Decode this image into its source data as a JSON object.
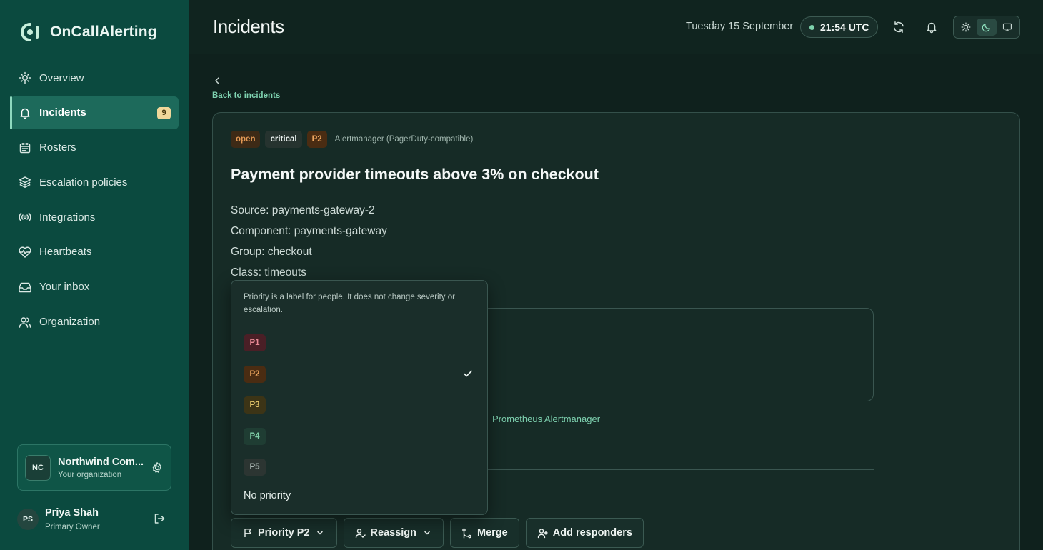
{
  "app": {
    "name": "OnCallAlerting"
  },
  "sidebar": {
    "items": [
      {
        "label": "Overview",
        "icon": "sun-icon"
      },
      {
        "label": "Incidents",
        "icon": "bell-icon",
        "badge": "9",
        "active": true
      },
      {
        "label": "Rosters",
        "icon": "calendar-icon"
      },
      {
        "label": "Escalation policies",
        "icon": "layers-icon"
      },
      {
        "label": "Integrations",
        "icon": "broadcast-icon"
      },
      {
        "label": "Heartbeats",
        "icon": "heart-pulse-icon"
      },
      {
        "label": "Your inbox",
        "icon": "inbox-icon"
      },
      {
        "label": "Organization",
        "icon": "users-icon"
      }
    ],
    "org": {
      "initials": "NC",
      "name": "Northwind Com...",
      "subtitle": "Your organization"
    },
    "user": {
      "initials": "PS",
      "name": "Priya Shah",
      "role": "Primary Owner"
    }
  },
  "header": {
    "title": "Incidents",
    "date": "Tuesday 15 September",
    "time": "21:54 UTC",
    "theme_selected": "dark"
  },
  "back": {
    "label": "Back to incidents"
  },
  "incident": {
    "tags": {
      "status": "open",
      "severity": "critical",
      "priority": "P2"
    },
    "source_integration": "Alertmanager (PagerDuty-compatible)",
    "title": "Payment provider timeouts above 3% on checkout",
    "meta": [
      "Source: payments-gateway-2",
      "Component: payments-gateway",
      "Group: checkout",
      "Class: timeouts"
    ],
    "via_text": "Prometheus Alertmanager"
  },
  "priority_menu": {
    "hint": "Priority is a label for people. It does not change severity or escalation.",
    "options": [
      {
        "label": "P1",
        "bg": "#4a1f26",
        "fg": "#e88a95",
        "selected": false
      },
      {
        "label": "P2",
        "bg": "#4a2c12",
        "fg": "#f0a860",
        "selected": true
      },
      {
        "label": "P3",
        "bg": "#3c3416",
        "fg": "#e2c46a",
        "selected": false
      },
      {
        "label": "P4",
        "bg": "#1f3d33",
        "fg": "#7fcfa8",
        "selected": false
      },
      {
        "label": "P5",
        "bg": "#2c3532",
        "fg": "#a9b6b2",
        "selected": false
      }
    ],
    "no_priority": "No priority"
  },
  "actions": {
    "priority": "Priority P2",
    "reassign": "Reassign",
    "merge": "Merge",
    "add_responders": "Add responders"
  },
  "colors": {
    "sidebar_bg": "#0b4a3f",
    "accent": "#7fd3b1",
    "page_bg": "#0f211d"
  }
}
